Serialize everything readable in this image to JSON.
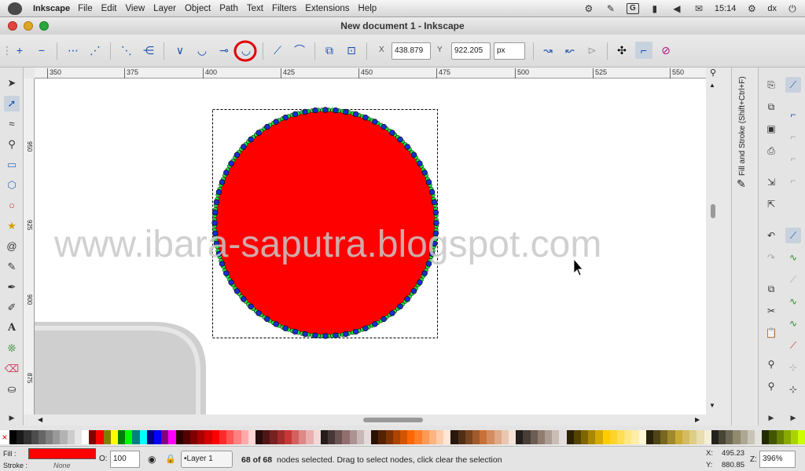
{
  "menubar": {
    "app_name": "Inkscape",
    "items": [
      "File",
      "Edit",
      "View",
      "Layer",
      "Object",
      "Path",
      "Text",
      "Filters",
      "Extensions",
      "Help"
    ],
    "clock": "15:14",
    "user": "dx"
  },
  "window": {
    "title": "New document 1 - Inkscape"
  },
  "toolbar": {
    "x_label": "X",
    "x_value": "438.879",
    "y_label": "Y",
    "y_value": "922.205",
    "unit": "px"
  },
  "ruler": {
    "ticks": [
      "350",
      "375",
      "400",
      "425",
      "450",
      "475",
      "500",
      "525",
      "550"
    ]
  },
  "canvas": {
    "watermark": "www.ibara-saputra.blogspot.com",
    "shape_fill": "#ff0000",
    "node_count": 68
  },
  "dock": {
    "fill_stroke_label": "Fill and Stroke (Shift+Ctrl+F)"
  },
  "status": {
    "fill_label": "Fill :",
    "stroke_label": "Stroke :",
    "stroke_value": "None",
    "fill_color": "#ff0000",
    "opacity_label": "O:",
    "opacity_value": "100",
    "layer_value": "•Layer 1",
    "message_bold": "68 of 68",
    "message_rest": " nodes selected. Drag to select nodes, click clear the selection",
    "coord_x_label": "X:",
    "coord_x": "495.23",
    "coord_y_label": "Y:",
    "coord_y": "880.85",
    "zoom_label": "Z:",
    "zoom_value": "396%"
  },
  "palette": [
    "#000000",
    "#1a1a1a",
    "#333333",
    "#4d4d4d",
    "#666666",
    "#808080",
    "#999999",
    "#b3b3b3",
    "#cccccc",
    "#e6e6e6",
    "#ffffff",
    "#800000",
    "#ff0000",
    "#808000",
    "#ffff00",
    "#008000",
    "#00ff00",
    "#008080",
    "#00ffff",
    "#000080",
    "#0000ff",
    "#800080",
    "#ff00ff",
    "#2b0000",
    "#550000",
    "#800000",
    "#aa0000",
    "#d40000",
    "#ff0000",
    "#ff2a2a",
    "#ff5555",
    "#ff8080",
    "#ffaaaa",
    "#ffd5d5",
    "#280b0b",
    "#501616",
    "#782121",
    "#a02c2c",
    "#c83737",
    "#d35f5f",
    "#de8787",
    "#e9afaf",
    "#f4d7d7",
    "#241c1c",
    "#483737",
    "#6c5353",
    "#916f6f",
    "#ac9393",
    "#c8b7b7",
    "#e3dbdb",
    "#2b1100",
    "#552200",
    "#803300",
    "#aa4400",
    "#d45500",
    "#ff6600",
    "#ff7f2a",
    "#ff9955",
    "#ffb380",
    "#ffccaa",
    "#ffe6d5",
    "#28170b",
    "#502d16",
    "#784421",
    "#a05a2c",
    "#c87137",
    "#d38d5f",
    "#deaa87",
    "#e9c6af",
    "#f4e3d7",
    "#241f1c",
    "#483e37",
    "#6c5d53",
    "#917c6f",
    "#ac9d93",
    "#c8beb7",
    "#e3dedb",
    "#2b2200",
    "#554400",
    "#806600",
    "#aa8800",
    "#d4aa00",
    "#ffcc00",
    "#ffd42a",
    "#ffdd55",
    "#ffe680",
    "#ffeeaa",
    "#fff6d5",
    "#28220b",
    "#504416",
    "#786721",
    "#a0892c",
    "#c8ab37",
    "#d3bc5f",
    "#decd87",
    "#e9ddaf",
    "#f4eed7",
    "#24221c",
    "#484537",
    "#6c6753",
    "#918a6f",
    "#aca793",
    "#c8c4b7",
    "#e3e2db",
    "#222b00",
    "#445500",
    "#668000",
    "#88aa00",
    "#aad400",
    "#ccff00"
  ]
}
